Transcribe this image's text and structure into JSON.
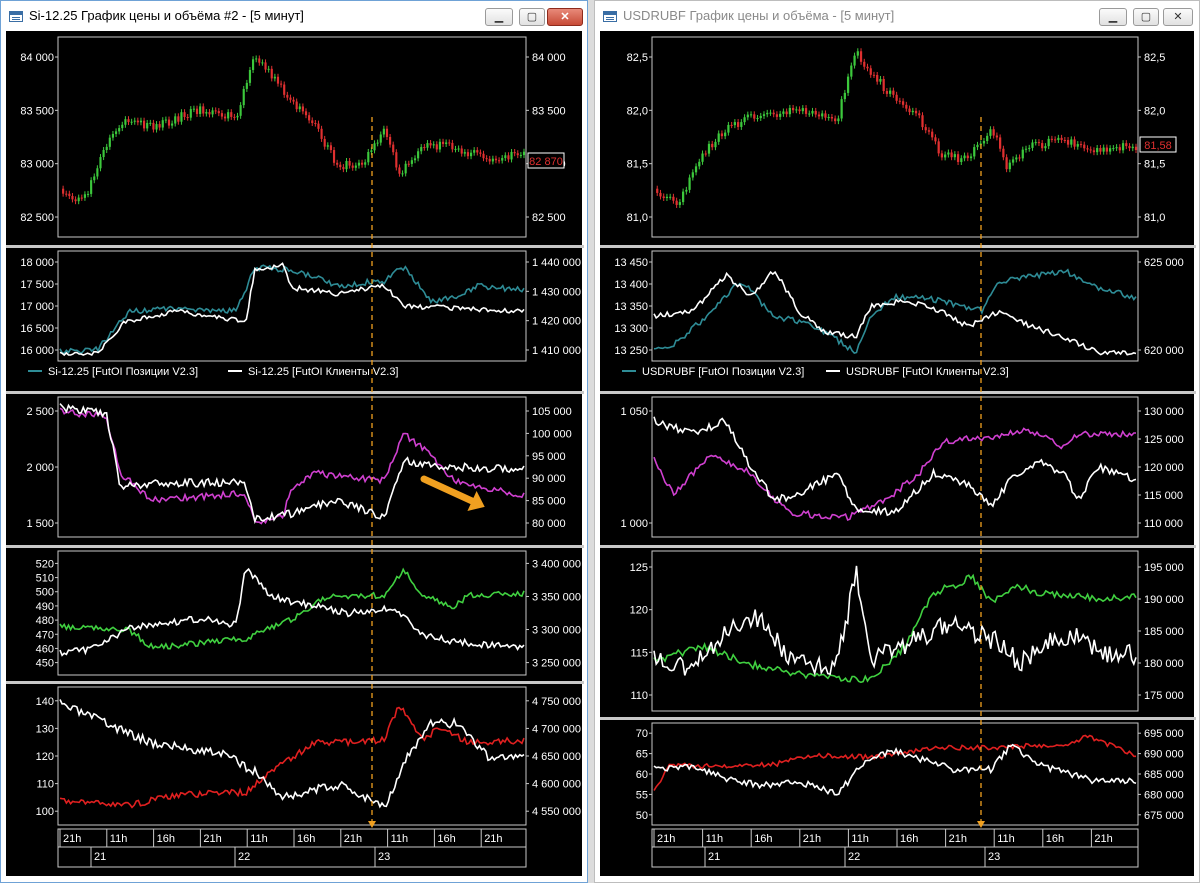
{
  "colors": {
    "bg": "#000000",
    "up_candle": "#3cc83c",
    "down_candle": "#e03030",
    "teal": "#2e8c96",
    "white": "#ffffff",
    "magenta": "#d040d0",
    "green": "#40d040",
    "red": "#e02020",
    "crosshair": "#f0a020",
    "arrow": "#f0a020"
  },
  "windows": [
    {
      "title": "Si-12.25 График цены и объёма #2 - [5 минут]",
      "icon": "chart-window-icon",
      "buttons": [
        "minimize-icon",
        "maximize-icon",
        "close-icon"
      ],
      "price_badge": "82 870",
      "legend": [
        {
          "label": "Si-12.25 [FutOI Позиции V2.3]",
          "color": "#2e8c96"
        },
        {
          "label": "Si-12.25 [FutOI Клиенты V2.3]",
          "color": "#ffffff"
        }
      ],
      "panes": [
        {
          "left_ticks": [
            "84 000",
            "83 500",
            "83 000",
            "82 500"
          ],
          "right_ticks": [
            "84 000",
            "83 500",
            "83 000",
            "82 500"
          ]
        },
        {
          "left_ticks": [
            "18 000",
            "17 500",
            "17 000",
            "16 500",
            "16 000"
          ],
          "right_ticks": [
            "1 440 000",
            "1 430 000",
            "1 420 000",
            "1 410 000"
          ]
        },
        {
          "left_ticks": [
            "2 500",
            "2 000",
            "1 500"
          ],
          "right_ticks": [
            "105 000",
            "100 000",
            "95 000",
            "90 000",
            "85 000",
            "80 000"
          ]
        },
        {
          "left_ticks": [
            "520",
            "510",
            "500",
            "490",
            "480",
            "470",
            "460",
            "450"
          ],
          "right_ticks": [
            "3 400 000",
            "3 350 000",
            "3 300 000",
            "3 250 000"
          ]
        },
        {
          "left_ticks": [
            "140",
            "130",
            "120",
            "110",
            "100"
          ],
          "right_ticks": [
            "4 750 000",
            "4 700 000",
            "4 650 000",
            "4 600 000",
            "4 550 000"
          ]
        }
      ],
      "time_ticks": [
        "21h",
        "11h",
        "16h",
        "21h",
        "11h",
        "16h",
        "21h",
        "11h",
        "16h",
        "21h"
      ],
      "date_ticks": [
        "21",
        "22",
        "23"
      ]
    },
    {
      "title": "USDRUBF График цены и объёма - [5 минут]",
      "icon": "chart-window-icon",
      "buttons": [
        "minimize-icon",
        "maximize-icon",
        "close-icon"
      ],
      "price_badge": "81,58",
      "legend": [
        {
          "label": "USDRUBF [FutOI Позиции V2.3]",
          "color": "#2e8c96"
        },
        {
          "label": "USDRUBF [FutOI Клиенты V2.3]",
          "color": "#ffffff"
        }
      ],
      "panes": [
        {
          "left_ticks": [
            "82,5",
            "82,0",
            "81,5",
            "81,0"
          ],
          "right_ticks": [
            "82,5",
            "82,0",
            "81,5",
            "81,0"
          ]
        },
        {
          "left_ticks": [
            "13 450",
            "13 400",
            "13 350",
            "13 300",
            "13 250"
          ],
          "right_ticks": [
            "625 000",
            "620 000"
          ]
        },
        {
          "left_ticks": [
            "1 050",
            "1 000"
          ],
          "right_ticks": [
            "130 000",
            "125 000",
            "120 000",
            "115 000",
            "110 000"
          ]
        },
        {
          "left_ticks": [
            "125",
            "120",
            "115",
            "110"
          ],
          "right_ticks": [
            "195 000",
            "190 000",
            "185 000",
            "180 000",
            "175 000"
          ]
        },
        {
          "left_ticks": [
            "70",
            "65",
            "60",
            "55",
            "50"
          ],
          "right_ticks": [
            "695 000",
            "690 000",
            "685 000",
            "680 000",
            "675 000"
          ]
        }
      ],
      "time_ticks": [
        "21h",
        "11h",
        "16h",
        "21h",
        "11h",
        "16h",
        "21h",
        "11h",
        "16h",
        "21h"
      ],
      "date_ticks": [
        "21",
        "22",
        "23"
      ]
    }
  ]
}
